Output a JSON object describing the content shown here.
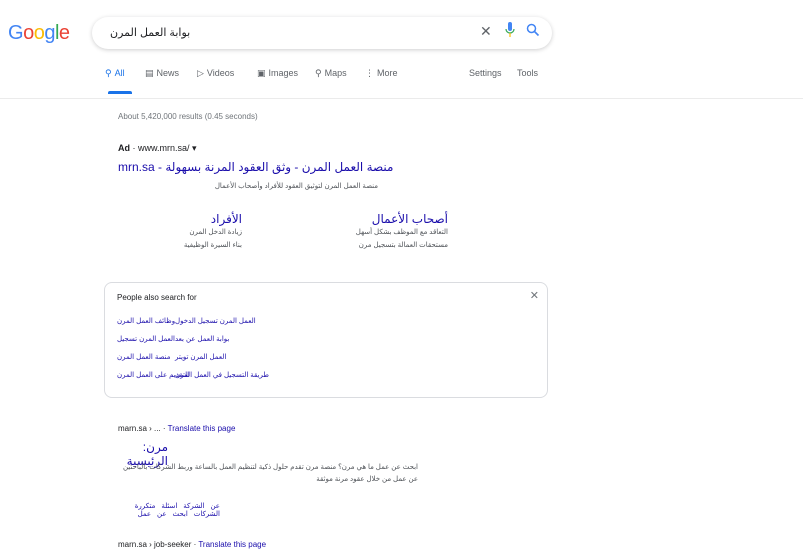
{
  "header": {
    "logo": "Google",
    "logo_colors": [
      "#4285f4",
      "#ea4335",
      "#fbbc05",
      "#4285f4",
      "#34a853",
      "#ea4335"
    ],
    "search_query": "بوابة العمل المرن",
    "clear_icon": "close-icon",
    "mic_icon": "mic-icon",
    "search_icon": "search-icon"
  },
  "tabs": [
    {
      "label": "All",
      "icon": "search-icon"
    },
    {
      "label": "News",
      "icon": "news-icon"
    },
    {
      "label": "Videos",
      "icon": "video-icon"
    },
    {
      "label": "Images",
      "icon": "image-icon"
    },
    {
      "label": "Maps",
      "icon": "map-pin-icon"
    },
    {
      "label": "More",
      "icon": "more-icon"
    }
  ],
  "tools": {
    "settings": "Settings",
    "tools": "Tools"
  },
  "stats": "About 5,420,000 results (0.45 seconds)",
  "ad": {
    "badge": "Ad",
    "url": "www.mrn.sa/",
    "title_domain": "mrn.sa",
    "title_text": "منصة العمل المرن - وثق العقود المرنة بسهولة",
    "description": "منصة العمل المرن لتوثيق العقود للأفراد وأصحاب الأعمال",
    "sitelinks": [
      {
        "title": "أصحاب الأعمال",
        "desc1": "التعاقد مع الموظف بشكل أسهل",
        "desc2": "مستحقات العمالة بتسجيل مرن"
      },
      {
        "title": "الأفراد",
        "desc1": "زيادة الدخل المرن",
        "desc2": "بناء السيرة الوظيفية"
      }
    ]
  },
  "people_also_search": {
    "title": "People also search for",
    "links": [
      [
        "العمل المرن تسجيل الدخول",
        "وظائف العمل المرن"
      ],
      [
        "بوابة العمل عن بعد",
        "العمل المرن تسجيل"
      ],
      [
        "العمل المرن تويتر",
        "منصة العمل المرن"
      ],
      [
        "طريقة التسجيل في العمل المرن",
        "التقديم على العمل المرن"
      ]
    ]
  },
  "results": [
    {
      "url": "marn.sa › ...",
      "translate": "Translate this page",
      "title": "مرن: الرئيسية",
      "desc": "ابحث عن عمل ما هي مرن؟ منصة مرن تقدم حلول ذكية لتنظيم العمل بالساعة وربط الشركات بالباحثين عن عمل من خلال عقود مرنة موثقة",
      "links": [
        "عن الشركة",
        "اسئلة متكررة",
        "الشركات",
        "ابحث عن عمل"
      ]
    },
    {
      "url": "marn.sa › job-seeker",
      "translate": "Translate this page",
      "title": "",
      "desc": "",
      "links": []
    }
  ]
}
